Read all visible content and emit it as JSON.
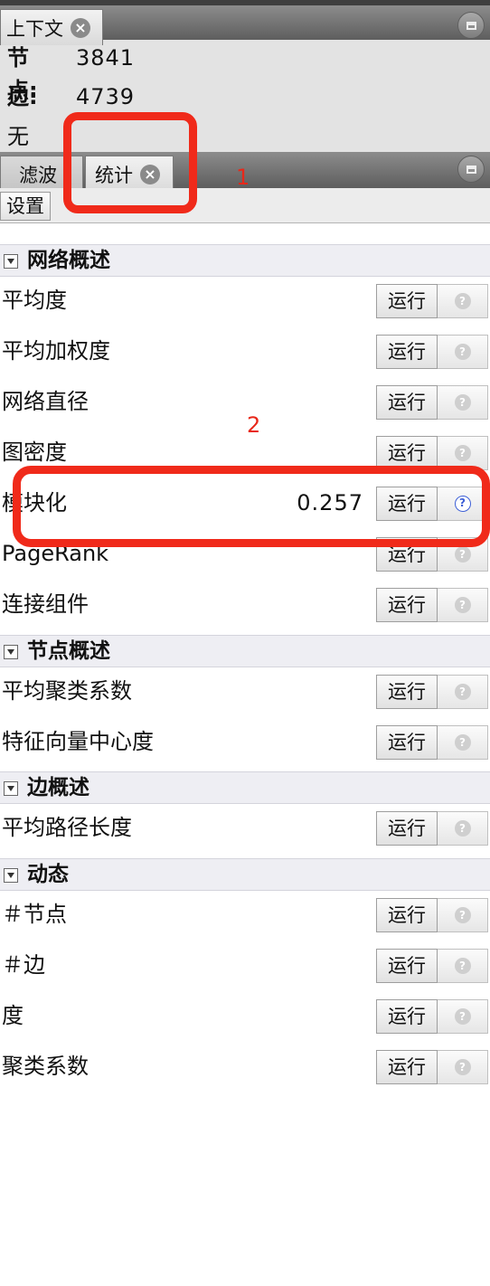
{
  "context_panel": {
    "tab_label": "上下文",
    "nodes_label": "节点:",
    "nodes_value": "3841",
    "edges_label": "边:",
    "edges_value": "4739",
    "graph_type": "无向图"
  },
  "stats_panel": {
    "tabs": [
      {
        "label": "滤波"
      },
      {
        "label": "统计"
      }
    ],
    "settings_label": "设置",
    "run_label": "运行",
    "sections": [
      {
        "title": "网络概述",
        "items": [
          {
            "label": "平均度",
            "value": ""
          },
          {
            "label": "平均加权度",
            "value": ""
          },
          {
            "label": "网络直径",
            "value": ""
          },
          {
            "label": "图密度",
            "value": ""
          },
          {
            "label": "模块化",
            "value": "0.257"
          },
          {
            "label": "PageRank",
            "value": ""
          },
          {
            "label": "连接组件",
            "value": ""
          }
        ]
      },
      {
        "title": "节点概述",
        "items": [
          {
            "label": "平均聚类系数",
            "value": ""
          },
          {
            "label": "特征向量中心度",
            "value": ""
          }
        ]
      },
      {
        "title": "边概述",
        "items": [
          {
            "label": "平均路径长度",
            "value": ""
          }
        ]
      },
      {
        "title": "动态",
        "items": [
          {
            "label": "＃节点",
            "value": ""
          },
          {
            "label": "＃边",
            "value": ""
          },
          {
            "label": "度",
            "value": ""
          },
          {
            "label": "聚类系数",
            "value": ""
          }
        ]
      }
    ]
  },
  "annotations": {
    "label_1": "1",
    "label_2": "2",
    "color": "#f02a1a"
  },
  "icons": {
    "close": "close-icon",
    "minimize": "minimize-icon",
    "collapse": "collapse-triangle-icon",
    "help": "help-icon"
  }
}
